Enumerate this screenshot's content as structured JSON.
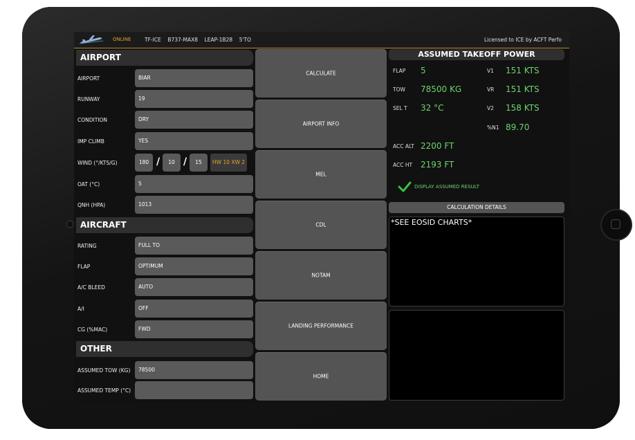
{
  "topbar": {
    "status": "ONLINE",
    "registration": "TF-ICE",
    "aircraft_type": "B737-MAX8",
    "engine": "LEAP-1B28",
    "mode": "5'TO",
    "license": "Licensed to ICE by ACFT Perfo"
  },
  "airport": {
    "title": "AIRPORT",
    "rows": [
      {
        "label": "AIRPORT",
        "value": "BIAR"
      },
      {
        "label": "RUNWAY",
        "value": "19"
      },
      {
        "label": "CONDITION",
        "value": "DRY"
      },
      {
        "label": "IMP CLIMB",
        "value": "YES"
      }
    ],
    "wind": {
      "label": "WIND (°/KTS/G)",
      "direction": "180",
      "speed": "10",
      "gust": "15",
      "components": "HW 10 XW 2"
    },
    "oat": {
      "label": "OAT (°C)",
      "value": "5"
    },
    "qnh": {
      "label": "QNH (HPA)",
      "value": "1013"
    }
  },
  "aircraft": {
    "title": "AIRCRAFT",
    "rows": [
      {
        "label": "RATING",
        "value": "FULL TO"
      },
      {
        "label": "FLAP",
        "value": "OPTIMUM"
      },
      {
        "label": "A/C BLEED",
        "value": "AUTO"
      },
      {
        "label": "A/I",
        "value": "OFF"
      },
      {
        "label": "CG (%MAC)",
        "value": "FWD"
      }
    ]
  },
  "other": {
    "title": "OTHER",
    "rows": [
      {
        "label": "ASSUMED TOW (KG)",
        "value": "78500"
      },
      {
        "label": "ASSUMED TEMP (°C)",
        "value": ""
      }
    ]
  },
  "commands": [
    "CALCULATE",
    "AIRPORT INFO",
    "MEL",
    "CDL",
    "NOTAM",
    "LANDING PERFORMANCE",
    "HOME"
  ],
  "result": {
    "title": "ASSUMED TAKEOFF POWER",
    "flap_label": "FLAP",
    "flap": "5",
    "tow_label": "TOW",
    "tow": "78500 KG",
    "selt_label": "SEL T",
    "selt": "32 °C",
    "v1_label": "V1",
    "v1": "151 KTS",
    "vr_label": "VR",
    "vr": "151 KTS",
    "v2_label": "V2",
    "v2": "158 KTS",
    "n1_label": "%N1",
    "n1": "89.70",
    "accalt_label": "ACC ALT",
    "accalt": "2200 FT",
    "accht_label": "ACC HT",
    "accht": "2193 FT",
    "display_assumed": "DISPLAY ASSUMED RESULT",
    "details_button": "CALCULATION DETAILS",
    "details_text": "*SEE EOSID CHARTS*"
  },
  "colors": {
    "accent_orange": "#e8a32c",
    "result_green": "#6fd36f",
    "panel_gray": "#5a5a5a"
  }
}
